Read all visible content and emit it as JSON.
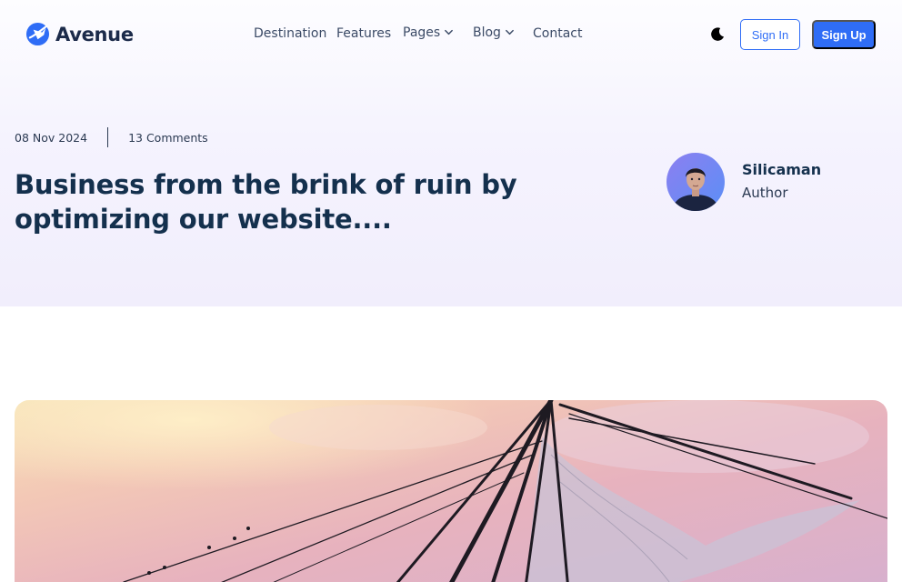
{
  "brand": {
    "name": "Avenue",
    "accent_color": "#2f6df6",
    "logo_icon": "airplane-circle-icon"
  },
  "nav": {
    "items": [
      {
        "label": "Destination",
        "has_dropdown": false
      },
      {
        "label": "Features",
        "has_dropdown": false
      },
      {
        "label": "Pages",
        "has_dropdown": true
      },
      {
        "label": "Blog",
        "has_dropdown": true
      },
      {
        "label": "Contact",
        "has_dropdown": false
      }
    ]
  },
  "header_actions": {
    "theme_toggle_icon": "moon-icon",
    "signin_label": "Sign In",
    "signup_label": "Sign Up"
  },
  "post": {
    "date": "08 Nov 2024",
    "comments": "13 Comments",
    "title": "Business from the brink of ruin by optimizing our website....",
    "author": {
      "name": "Silicaman",
      "role": "Author"
    }
  },
  "featured_image": {
    "icon": "fishing-net-photo"
  }
}
